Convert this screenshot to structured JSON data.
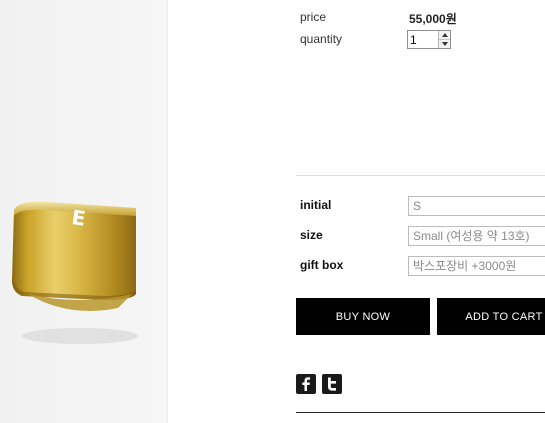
{
  "product": {
    "price_label": "price",
    "price_value": "55,000원",
    "quantity_label": "quantity",
    "quantity_value": "1"
  },
  "options": {
    "initial_label": "initial",
    "initial_value": "S",
    "size_label": "size",
    "size_value": "Small (여성용 약 13호)",
    "gift_label": "gift box",
    "gift_value": "박스포장비 +3000원"
  },
  "actions": {
    "buy_now": "BUY NOW",
    "add_to_cart": "ADD TO CART"
  },
  "photo": {
    "engraved_letter": "E"
  },
  "social": {
    "icons": [
      "facebook-icon",
      "twitter-icon"
    ]
  },
  "colors": {
    "button_bg": "#000000",
    "button_text": "#ffffff",
    "gold": "#c9a227"
  }
}
